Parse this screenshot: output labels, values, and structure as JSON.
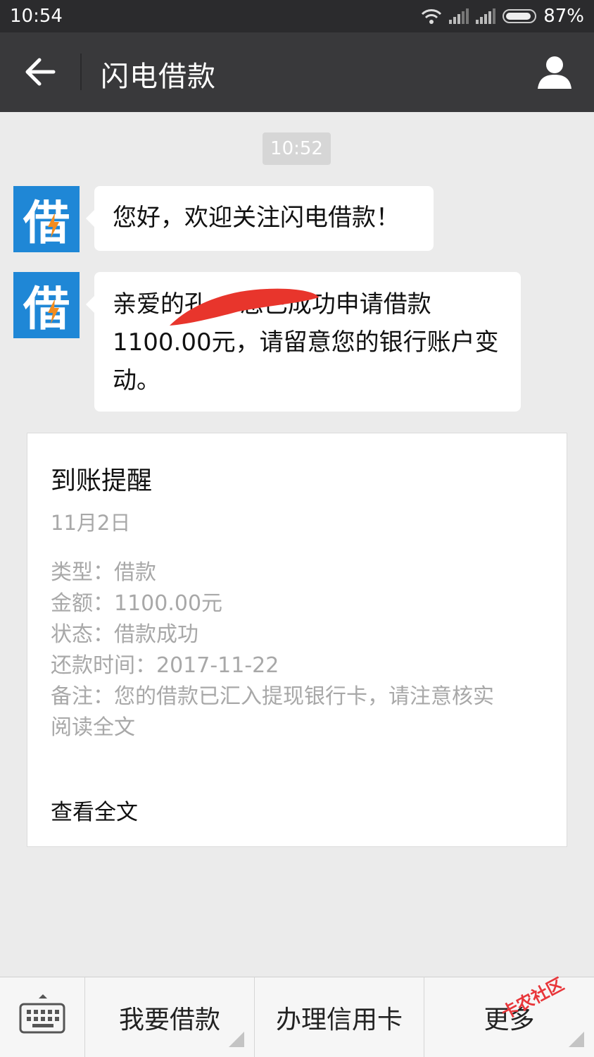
{
  "status_bar": {
    "time": "10:54",
    "battery": "87%"
  },
  "nav": {
    "title": "闪电借款"
  },
  "chat": {
    "timestamp": "10:52",
    "avatar_char": "借",
    "messages": [
      {
        "text": "您好，欢迎关注闪电借款！"
      },
      {
        "lines": [
          "亲爱的孔    ，您已成功申请借款",
          "1100.00元，请留意您的银行账户变",
          "动。"
        ]
      }
    ]
  },
  "card": {
    "title": "到账提醒",
    "date": "11月2日",
    "rows": [
      "类型：借款",
      "金额：1100.00元",
      "状态：借款成功",
      "还款时间：2017-11-22",
      "备注：您的借款已汇入提现银行卡，请注意核实",
      "阅读全文"
    ],
    "footer": "查看全文"
  },
  "bottom_menu": {
    "items": [
      "我要借款",
      "办理信用卡",
      "更多"
    ]
  },
  "watermark": "卡农社区",
  "colors": {
    "status_bar": "#2b2b2d",
    "nav_bar": "#39393b",
    "avatar": "#1f87d6",
    "redaction": "#e8352c",
    "watermark": "#e8363a"
  }
}
